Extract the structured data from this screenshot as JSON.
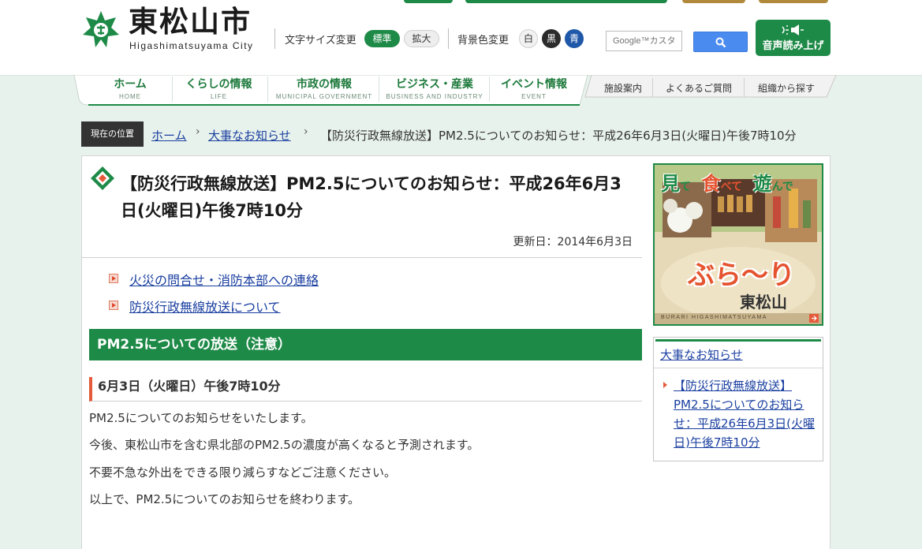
{
  "header": {
    "logo_jp": "東松山市",
    "logo_en": "Higashimatsuyama City",
    "font_size_label": "文字サイズ変更",
    "font_standard": "標準",
    "font_large": "拡大",
    "bg_color_label": "背景色変更",
    "bg_white": "白",
    "bg_black": "黒",
    "bg_blue": "青",
    "search_placeholder": "Google™カスタ",
    "voice_label": "音声読み上げ"
  },
  "nav": {
    "items": [
      {
        "jp": "ホーム",
        "en": "HOME"
      },
      {
        "jp": "くらしの情報",
        "en": "LIFE"
      },
      {
        "jp": "市政の情報",
        "en": "MUNICIPAL GOVERNMENT"
      },
      {
        "jp": "ビジネス・産業",
        "en": "BUSINESS AND INDUSTRY"
      },
      {
        "jp": "イベント情報",
        "en": "EVENT"
      }
    ],
    "sub_items": [
      "施設案内",
      "よくあるご質問",
      "組織から探す"
    ]
  },
  "breadcrumb": {
    "label": "現在の位置",
    "home": "ホーム",
    "notices": "大事なお知らせ",
    "current": "【防災行政無線放送】PM2.5についてのお知らせ：平成26年6月3日(火曜日)午後7時10分"
  },
  "article": {
    "title": "【防災行政無線放送】PM2.5についてのお知らせ：平成26年6月3日(火曜日)午後7時10分",
    "updated": "更新日：2014年6月3日",
    "related": [
      "火災の問合せ・消防本部への連絡",
      "防災行政無線放送について"
    ],
    "section_heading": "PM2.5についての放送（注意）",
    "sub_heading": "6月3日（火曜日）午後7時10分",
    "paragraphs": [
      "PM2.5についてのお知らせをいたします。",
      "今後、東松山市を含む県北部のPM2.5の濃度が高くなると予測されます。",
      "不要不急な外出をできる限り減らすなどご注意ください。",
      "以上で、PM2.5についてのお知らせを終わります。"
    ]
  },
  "sidebar": {
    "banner": {
      "top_text_1": "見",
      "top_text_2": "て",
      "top_text_3": "食",
      "top_text_4": "べて",
      "top_text_5": "遊",
      "top_text_6": "んで",
      "brand": "ぶら〜り",
      "city": "東松山",
      "footer": "BURARI HIGASHIMATSUYAMA"
    },
    "notice_heading": "大事なお知らせ",
    "notice_item": "【防災行政無線放送】PM2.5についてのお知らせ：平成26年6月3日(火曜日)午後7時10分"
  },
  "colors": {
    "primary_green": "#1e8a47",
    "accent_red": "#e55a3a",
    "link_blue": "#1a3fa0",
    "page_bg": "#e8f2ec"
  }
}
